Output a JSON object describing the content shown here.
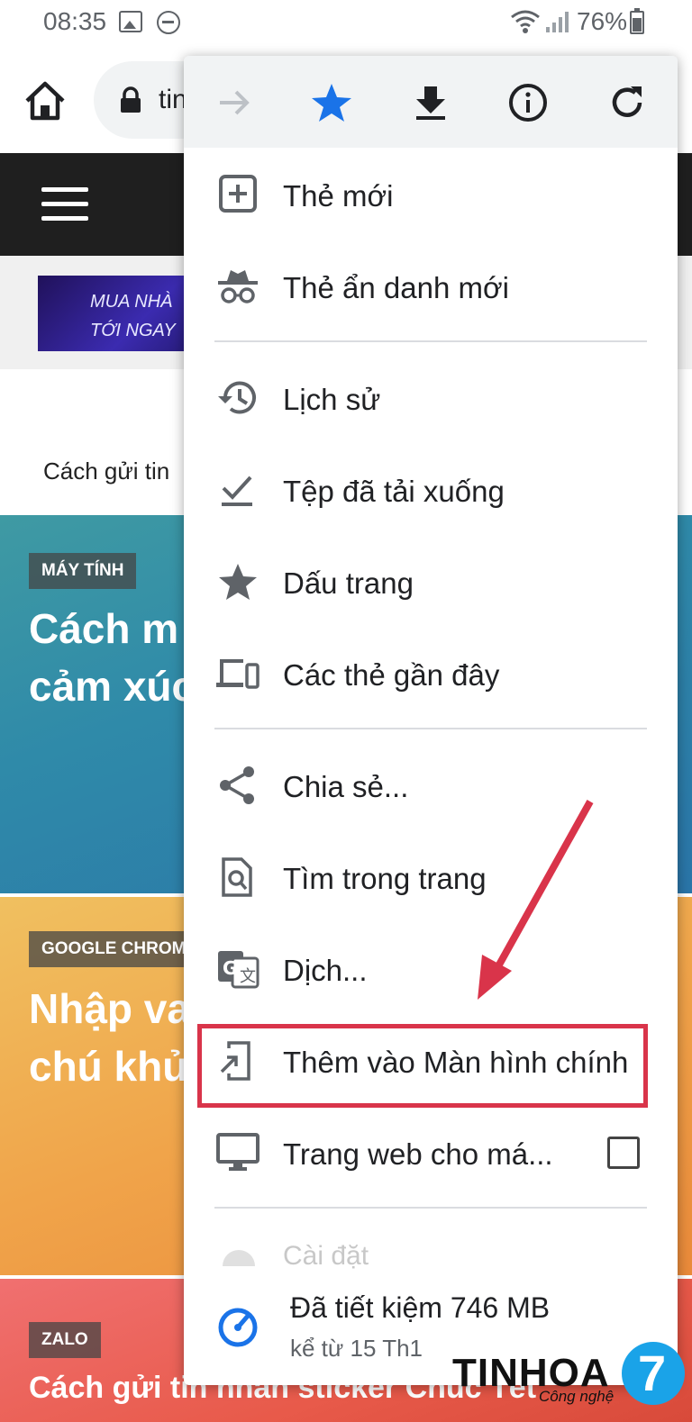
{
  "status_bar": {
    "time": "08:35",
    "battery": "76%"
  },
  "browser": {
    "url_text": "tin"
  },
  "page": {
    "ad_line1": "MUA NHÀ",
    "ad_line2": "TỚI NGAY",
    "ticker": "Cách gửi tin",
    "cards": [
      {
        "badge": "MÁY TÍNH",
        "title_line1": "Cách m",
        "title_line2": "cảm xúc"
      },
      {
        "badge": "GOOGLE CHROM",
        "title_line1": "Nhập va",
        "title_line2": "chú khủ"
      },
      {
        "badge": "ZALO",
        "title_line1": "Cách gửi tin nhắn sticker Chúc Tết"
      }
    ]
  },
  "menu": {
    "topbar_icons": [
      "forward-arrow-icon",
      "bookmark-star-icon",
      "download-icon",
      "info-icon",
      "refresh-icon"
    ],
    "items": [
      {
        "label": "Thẻ mới",
        "icon": "new-tab-icon"
      },
      {
        "label": "Thẻ ẩn danh mới",
        "icon": "incognito-icon"
      },
      {
        "label": "Lịch sử",
        "icon": "history-icon"
      },
      {
        "label": "Tệp đã tải xuống",
        "icon": "downloads-icon"
      },
      {
        "label": "Dấu trang",
        "icon": "bookmarks-star-icon"
      },
      {
        "label": "Các thẻ gần đây",
        "icon": "recent-tabs-icon"
      },
      {
        "label": "Chia sẻ...",
        "icon": "share-icon"
      },
      {
        "label": "Tìm trong trang",
        "icon": "find-in-page-icon"
      },
      {
        "label": "Dịch...",
        "icon": "translate-icon"
      },
      {
        "label": "Thêm vào Màn hình chính",
        "icon": "add-to-home-icon"
      },
      {
        "label": "Trang web cho má...",
        "icon": "desktop-icon"
      }
    ],
    "settings_label": "Cài đặt",
    "savings_title": "Đã tiết kiệm 746 MB",
    "savings_sub": "kể từ 15 Th1"
  },
  "watermark": {
    "brand": "TINHOA",
    "sub": "Công nghệ",
    "logo_num": "7"
  },
  "colors": {
    "accent_blue": "#1a73e8",
    "highlight_red": "#d9344a",
    "menu_bg": "#ffffff",
    "topbar_bg": "#f1f3f4"
  }
}
